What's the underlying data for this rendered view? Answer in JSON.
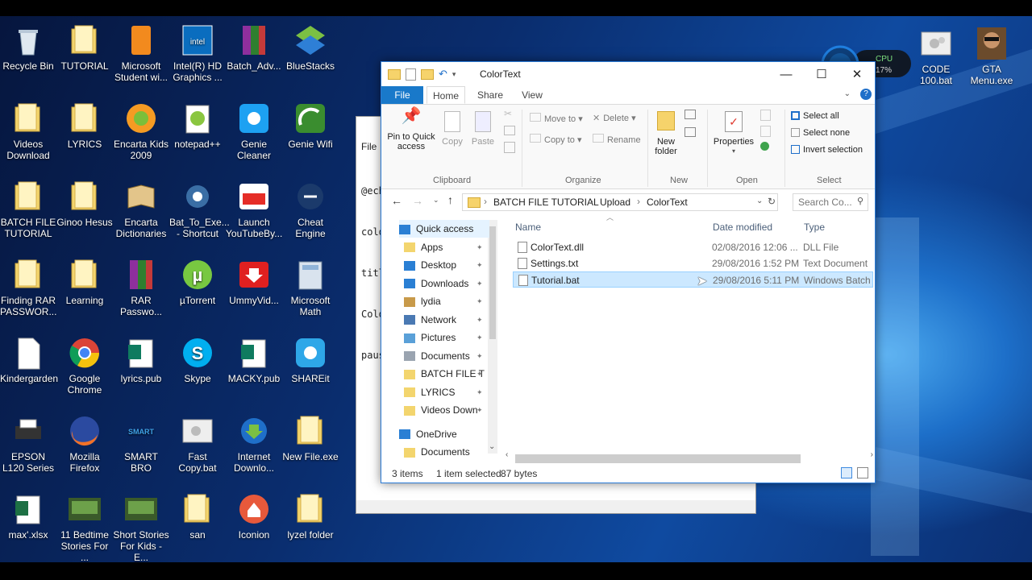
{
  "desktop_icons": [
    {
      "label": "Recycle Bin",
      "icon": "recycle-bin-icon",
      "col": 0,
      "row": 0
    },
    {
      "label": "TUTORIAL",
      "icon": "folder-icon",
      "col": 1,
      "row": 0
    },
    {
      "label": "Microsoft Student wi...",
      "icon": "office-icon",
      "col": 2,
      "row": 0
    },
    {
      "label": "Intel(R) HD Graphics ...",
      "icon": "intel-icon",
      "col": 3,
      "row": 0
    },
    {
      "label": "Batch_Adv...",
      "icon": "winrar-icon",
      "col": 4,
      "row": 0
    },
    {
      "label": "BlueStacks",
      "icon": "bluestacks-icon",
      "col": 5,
      "row": 0
    },
    {
      "label": "Videos Download",
      "icon": "folder-icon",
      "col": 0,
      "row": 1
    },
    {
      "label": "LYRICS",
      "icon": "folder-icon",
      "col": 1,
      "row": 1
    },
    {
      "label": "Encarta Kids 2009",
      "icon": "encarta-kids-icon",
      "col": 2,
      "row": 1
    },
    {
      "label": "notepad++",
      "icon": "notepadpp-icon",
      "col": 3,
      "row": 1
    },
    {
      "label": "Genie Cleaner",
      "icon": "twitter-bird-icon",
      "col": 4,
      "row": 1
    },
    {
      "label": "Genie Wifi",
      "icon": "wifi-icon",
      "col": 5,
      "row": 1
    },
    {
      "label": "BATCH FILE TUTORIAL",
      "icon": "folder-icon",
      "col": 0,
      "row": 2
    },
    {
      "label": "Ginoo Hesus",
      "icon": "folder-icon",
      "col": 1,
      "row": 2
    },
    {
      "label": "Encarta Dictionaries",
      "icon": "book-icon",
      "col": 2,
      "row": 2
    },
    {
      "label": "Bat_To_Exe... - Shortcut",
      "icon": "gear-icon",
      "col": 3,
      "row": 2
    },
    {
      "label": "Launch YouTubeBy...",
      "icon": "youtube-icon",
      "col": 4,
      "row": 2
    },
    {
      "label": "Cheat Engine",
      "icon": "cheat-engine-icon",
      "col": 5,
      "row": 2
    },
    {
      "label": "Finding RAR PASSWOR...",
      "icon": "folder-icon",
      "col": 0,
      "row": 3
    },
    {
      "label": "Learning",
      "icon": "folder-icon",
      "col": 1,
      "row": 3
    },
    {
      "label": "RAR Passwo...",
      "icon": "winrar-icon",
      "col": 2,
      "row": 3
    },
    {
      "label": "µTorrent",
      "icon": "utorrent-icon",
      "col": 3,
      "row": 3
    },
    {
      "label": "UmmyVid...",
      "icon": "download-icon",
      "col": 4,
      "row": 3
    },
    {
      "label": "Microsoft Math",
      "icon": "calculator-icon",
      "col": 5,
      "row": 3
    },
    {
      "label": "Kindergarden",
      "icon": "document-icon",
      "col": 0,
      "row": 4
    },
    {
      "label": "Google Chrome",
      "icon": "chrome-icon",
      "col": 1,
      "row": 4
    },
    {
      "label": "lyrics.pub",
      "icon": "publisher-icon",
      "col": 2,
      "row": 4
    },
    {
      "label": "Skype",
      "icon": "skype-icon",
      "col": 3,
      "row": 4
    },
    {
      "label": "MACKY.pub",
      "icon": "publisher-icon",
      "col": 4,
      "row": 4
    },
    {
      "label": "SHAREit",
      "icon": "shareit-icon",
      "col": 5,
      "row": 4
    },
    {
      "label": "EPSON L120 Series",
      "icon": "printer-icon",
      "col": 0,
      "row": 5
    },
    {
      "label": "Mozilla Firefox",
      "icon": "firefox-icon",
      "col": 1,
      "row": 5
    },
    {
      "label": "SMART BRO",
      "icon": "smartbro-icon",
      "col": 2,
      "row": 5
    },
    {
      "label": "Fast Copy.bat",
      "icon": "batch-file-icon",
      "col": 3,
      "row": 5
    },
    {
      "label": "Internet Downlo...",
      "icon": "idm-icon",
      "col": 4,
      "row": 5
    },
    {
      "label": "New File.exe",
      "icon": "folder-icon",
      "col": 5,
      "row": 5
    },
    {
      "label": "max'.xlsx",
      "icon": "excel-icon",
      "col": 0,
      "row": 6
    },
    {
      "label": "11 Bedtime Stories For ...",
      "icon": "video-thumb-icon",
      "col": 1,
      "row": 6
    },
    {
      "label": "Short Stories For Kids - E...",
      "icon": "video-thumb-icon",
      "col": 2,
      "row": 6
    },
    {
      "label": "san",
      "icon": "folder-icon",
      "col": 3,
      "row": 6
    },
    {
      "label": "Iconion",
      "icon": "iconion-icon",
      "col": 4,
      "row": 6
    },
    {
      "label": "lyzel folder",
      "icon": "folder-icon",
      "col": 5,
      "row": 6
    }
  ],
  "right_icons": [
    {
      "label": "CODE 100.bat",
      "icon": "batch-file-icon"
    },
    {
      "label": "GTA Menu.exe",
      "icon": "gta-icon"
    }
  ],
  "cpu_gadget": {
    "label": "CPU",
    "value": "17%"
  },
  "notepad": {
    "menu": "File",
    "lines": [
      "@ech",
      "colo",
      "titl",
      "Colo",
      "paus"
    ]
  },
  "explorer": {
    "title": "ColorText",
    "tabs": {
      "file": "File",
      "home": "Home",
      "share": "Share",
      "view": "View"
    },
    "ribbon": {
      "pin": "Pin to Quick access",
      "copy": "Copy",
      "paste": "Paste",
      "clipboard": "Clipboard",
      "move_to": "Move to",
      "copy_to": "Copy to",
      "delete": "Delete",
      "rename": "Rename",
      "organize": "Organize",
      "new_folder": "New folder",
      "new": "New",
      "properties": "Properties",
      "open": "Open",
      "select_all": "Select all",
      "select_none": "Select none",
      "invert_selection": "Invert selection",
      "select": "Select"
    },
    "breadcrumb": [
      "BATCH FILE TUTORIAL",
      "Upload",
      "ColorText"
    ],
    "search_placeholder": "Search Co...",
    "nav_items": [
      {
        "label": "Quick access",
        "icon": "star-icon",
        "pinned": false
      },
      {
        "label": "Apps",
        "icon": "folder-icon",
        "pinned": true
      },
      {
        "label": "Desktop",
        "icon": "desktop-icon",
        "pinned": true
      },
      {
        "label": "Downloads",
        "icon": "downloads-icon",
        "pinned": true
      },
      {
        "label": "lydia",
        "icon": "user-folder-icon",
        "pinned": true
      },
      {
        "label": "Network",
        "icon": "network-icon",
        "pinned": true
      },
      {
        "label": "Pictures",
        "icon": "pictures-icon",
        "pinned": true
      },
      {
        "label": "Documents",
        "icon": "documents-icon",
        "pinned": true
      },
      {
        "label": "BATCH FILE T",
        "icon": "folder-icon",
        "pinned": true
      },
      {
        "label": "LYRICS",
        "icon": "folder-icon",
        "pinned": true
      },
      {
        "label": "Videos Down",
        "icon": "folder-icon",
        "pinned": true
      },
      {
        "label": "OneDrive",
        "icon": "onedrive-icon",
        "pinned": false
      },
      {
        "label": "Documents",
        "icon": "folder-icon",
        "pinned": false
      }
    ],
    "columns": {
      "name": "Name",
      "date": "Date modified",
      "type": "Type"
    },
    "files": [
      {
        "name": "ColorText.dll",
        "date": "02/08/2016 12:06 ...",
        "type": "DLL File",
        "selected": false
      },
      {
        "name": "Settings.txt",
        "date": "29/08/2016 1:52 PM",
        "type": "Text Document",
        "selected": false
      },
      {
        "name": "Tutorial.bat",
        "date": "29/08/2016 5:11 PM",
        "type": "Windows Batch File",
        "selected": true
      }
    ],
    "status": {
      "items": "3 items",
      "selected": "1 item selected",
      "size": "87 bytes"
    }
  }
}
